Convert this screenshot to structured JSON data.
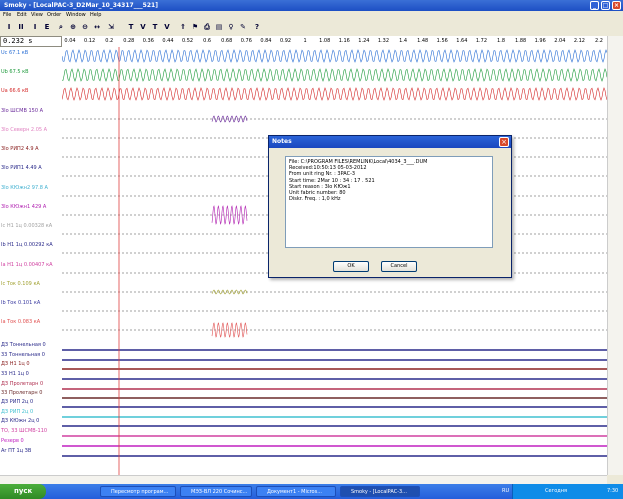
{
  "window": {
    "title": "Smoky - [LocalPAC-3_D2Mar_10_34317___521]"
  },
  "menu": [
    "File",
    "Edit",
    "View",
    "Order",
    "Window",
    "Help"
  ],
  "toolbar": [
    "I",
    "II",
    "I",
    "E",
    "T",
    "V",
    "T",
    "V"
  ],
  "time_display": "0.232 s",
  "ruler_ticks": [
    "0.04",
    "0.12",
    "0.2",
    "0.28",
    "0.36",
    "0.44",
    "0.52",
    "0.6",
    "0.68",
    "0.76",
    "0.84",
    "0.92",
    "1",
    "1.08",
    "1.16",
    "1.24",
    "1.32",
    "1.4",
    "1.48",
    "1.56",
    "1.64",
    "1.72",
    "1.8",
    "1.88",
    "1.96",
    "2.04",
    "2.12",
    "2.2"
  ],
  "channels": [
    {
      "label": "Uc  67.1 кВ",
      "color": "#2a6fd4"
    },
    {
      "label": "Ub  67.5 кВ",
      "color": "#1e9a3c"
    },
    {
      "label": "Ua  66.6 кВ",
      "color": "#d42a2a"
    },
    {
      "label": "3Io ШСМВ  150 А",
      "color": "#6a2a9a"
    },
    {
      "label": "3Io Северн 2.05 А",
      "color": "#e080c0"
    },
    {
      "label": "3Io РИП2  4.9 А",
      "color": "#8a2020"
    },
    {
      "label": "3Io РИП1  4.49 А",
      "color": "#2a2a8a"
    },
    {
      "label": "3Io КЮжн2 97.8 А",
      "color": "#40b0d0"
    },
    {
      "label": "3Io КЮжн1  429 А",
      "color": "#b020b0"
    },
    {
      "label": "Ic Н1 1ц 0.00328 кА",
      "color": "#a0a0a0"
    },
    {
      "label": "Ib Н1 1ц 0.00292 кА",
      "color": "#2a2a8a"
    },
    {
      "label": "Ia Н1 1ц 0.00407 кА",
      "color": "#d040a0"
    },
    {
      "label": "Ic Ток  0.109 кА",
      "color": "#a0a030"
    },
    {
      "label": "Ib Ток  0.101 кА",
      "color": "#3a3aa0"
    },
    {
      "label": "Ia Ток  0.083 кА",
      "color": "#e05050"
    },
    {
      "label": "ДЗ Тоннельная  0",
      "color": "#2a2a8a"
    },
    {
      "label": "33 Тоннельная  0",
      "color": "#2a2a8a"
    },
    {
      "label": "ДЗ Н1 1ц  0",
      "color": "#8a2020"
    },
    {
      "label": "33 Н1 1ц  0",
      "color": "#2a2a8a"
    },
    {
      "label": "ДЗ Пролетарн  0",
      "color": "#b03050"
    },
    {
      "label": "33 Пролетарн  0",
      "color": "#6a2a2a"
    },
    {
      "label": "ДЗ РИП 2ц  0",
      "color": "#2a2a8a"
    },
    {
      "label": "ДЗ РИП 2ц  0",
      "color": "#40c0d0"
    },
    {
      "label": "ДЗ КЮжн 2ц  0",
      "color": "#2a2a8a"
    },
    {
      "label": "ТО, 33 ШСМВ-110",
      "color": "#d040a0"
    },
    {
      "label": "Резерв  0",
      "color": "#c020c0"
    },
    {
      "label": "Ar ПТ 1ц ЗВ",
      "color": "#2a2a8a"
    }
  ],
  "dialog": {
    "title": "Notes",
    "lines": [
      "File: C:\\PROGRAM FILES\\REMLINK\\Local\\4034_3___.DUM",
      "Received:10:50:13 05-03-2012",
      "From unit ring Nr. : 3PAC-3",
      "Start time:  2Mar 10 : 34 : 17 . 521",
      "Start reason : 3Io КЮж1",
      "Unit fabric number:  80",
      "Diskr. Freq. : 1,0 kHz"
    ],
    "ok": "OK",
    "cancel": "Cancel"
  },
  "taskbar": {
    "start": "пуск",
    "tasks": [
      "Пересмотр програм...",
      "МЭЗ-ВЛ 220 Сочинс...",
      "Документ1 - Micros...",
      "Smoky - [LocalPAC-3..."
    ],
    "lang": "RU",
    "tray_text": "Сегодня",
    "clock": "7:30"
  }
}
